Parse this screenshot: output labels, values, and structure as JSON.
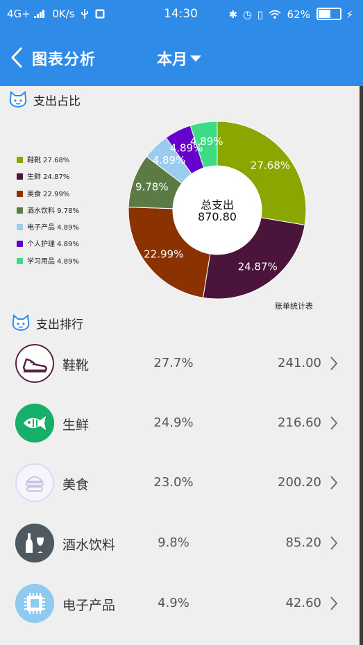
{
  "status_bar": {
    "network": "4G+",
    "speed": "0K/s",
    "time": "14:30",
    "battery": "62%",
    "battery_level": 0.62
  },
  "header": {
    "title": "图表分析",
    "period": "本月"
  },
  "sections": {
    "share_title": "支出占比",
    "ranking_title": "支出排行"
  },
  "chart_data": {
    "type": "pie",
    "categories": [
      "鞋靴",
      "生鲜",
      "美食",
      "酒水饮料",
      "电子产品",
      "个人护理",
      "学习用品"
    ],
    "values": [
      27.68,
      24.87,
      22.99,
      9.78,
      4.89,
      4.89,
      4.89
    ],
    "slice_labels": [
      "27.68%",
      "24.87%",
      "22.99%",
      "9.78%",
      "4.89%",
      "4.89%",
      "4.89%"
    ],
    "legend_labels": [
      "鞋靴 27.68%",
      "生鲜 24.87%",
      "美食 22.99%",
      "酒水饮料 9.78%",
      "电子产品 4.89%",
      "个人护理 4.89%",
      "学习用品 4.89%"
    ],
    "colors": [
      "#8aa600",
      "#4a143b",
      "#8b3300",
      "#5c7a44",
      "#99ccee",
      "#6600cc",
      "#3ddc84"
    ],
    "center_label": "总支出",
    "center_value": "870.80",
    "caption": "账单统计表",
    "legend_position": "left"
  },
  "ranking": [
    {
      "name": "鞋靴",
      "percent": "27.7%",
      "amount": "241.00",
      "icon": "sneaker-icon",
      "icon_bg": "#ffffff",
      "icon_ring": "#5a1f45"
    },
    {
      "name": "生鲜",
      "percent": "24.9%",
      "amount": "216.60",
      "icon": "fish-icon",
      "icon_bg": "#16b06b",
      "icon_ring": "#16b06b"
    },
    {
      "name": "美食",
      "percent": "23.0%",
      "amount": "200.20",
      "icon": "burger-icon",
      "icon_bg": "#f5f5fb",
      "icon_ring": "#dcd8f2"
    },
    {
      "name": "酒水饮料",
      "percent": "9.8%",
      "amount": "85.20",
      "icon": "drinks-icon",
      "icon_bg": "#4e5a60",
      "icon_ring": "#4e5a60"
    },
    {
      "name": "电子产品",
      "percent": "4.9%",
      "amount": "42.60",
      "icon": "chip-icon",
      "icon_bg": "#8fcbf0",
      "icon_ring": "#8fcbf0"
    }
  ]
}
